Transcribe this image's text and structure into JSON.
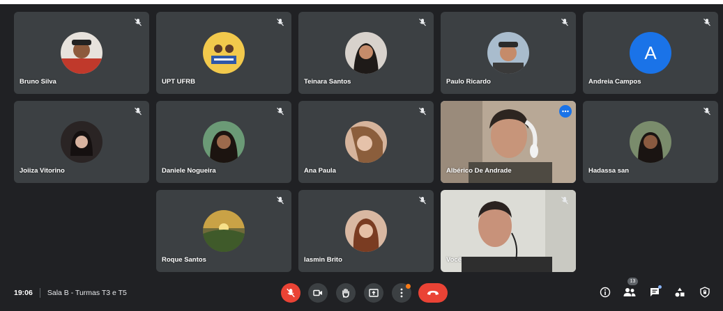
{
  "participants": [
    {
      "name": "Bruno Silva",
      "bg": "#b94a48"
    },
    {
      "name": "UPT UFRB",
      "bg": "#f2c94c"
    },
    {
      "name": "Teinara Santos",
      "bg": "#9a8a7c"
    },
    {
      "name": "Paulo Ricardo",
      "bg": "#9db1c4"
    },
    {
      "name": "Andreia Campos",
      "initial": "A",
      "bg": "#1a73e8"
    },
    {
      "name": "Joiiza Vitorino",
      "bg": "#3a3030"
    },
    {
      "name": "Daniele Nogueira",
      "bg": "#5d8a6a"
    },
    {
      "name": "Ana Paula",
      "bg": "#c9a58e"
    },
    {
      "name": "Albérico De Andrade"
    },
    {
      "name": "Hadassa san",
      "bg": "#6e7f63"
    },
    {
      "name": "Roque Santos",
      "bg": "#7a6a3a"
    },
    {
      "name": "Iasmin Brito",
      "bg": "#c79074"
    },
    {
      "name": "Você"
    }
  ],
  "meeting": {
    "time": "19:06",
    "room": "Sala B - Turmas T3 e T5"
  },
  "people_count": "13",
  "colors": {
    "background": "#202124",
    "tile": "#3c4043",
    "accent": "#1a73e8",
    "danger": "#ea4335",
    "notification": "#fa7b17"
  },
  "icons": [
    "mic-off-icon",
    "camera-icon",
    "raise-hand-icon",
    "present-icon",
    "more-options-icon",
    "hang-up-icon",
    "info-icon",
    "people-icon",
    "chat-icon",
    "activities-icon",
    "host-controls-icon"
  ]
}
